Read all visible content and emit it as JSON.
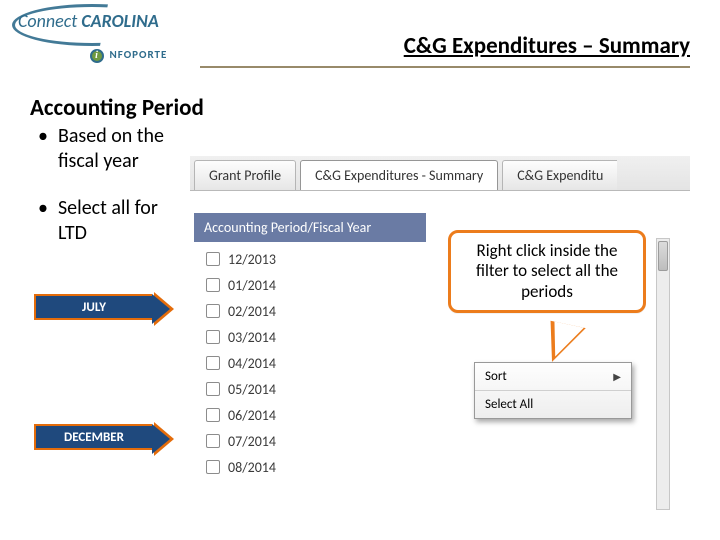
{
  "brand": {
    "connect": "Connect",
    "carolina": "CAROLINA",
    "sub": "NFOPORTE"
  },
  "page_title": "C&G Expenditures – Summary",
  "subtitle": "Accounting Period",
  "bullets": [
    "Based on the fiscal year",
    "Select all for LTD"
  ],
  "arrow_tags": {
    "july": "JULY",
    "december": "DECEMBER"
  },
  "tabs": {
    "grant_profile": "Grant Profile",
    "summary": "C&G Expenditures - Summary",
    "expend_cut": "C&G Expenditu"
  },
  "section_label": "Accounting Period/Fiscal Year",
  "periods": [
    "12/2013",
    "01/2014",
    "02/2014",
    "03/2014",
    "04/2014",
    "05/2014",
    "06/2014",
    "07/2014",
    "08/2014"
  ],
  "context_menu": {
    "sort": "Sort",
    "select_all": "Select All"
  },
  "callout": "Right click inside the filter to select all the periods"
}
